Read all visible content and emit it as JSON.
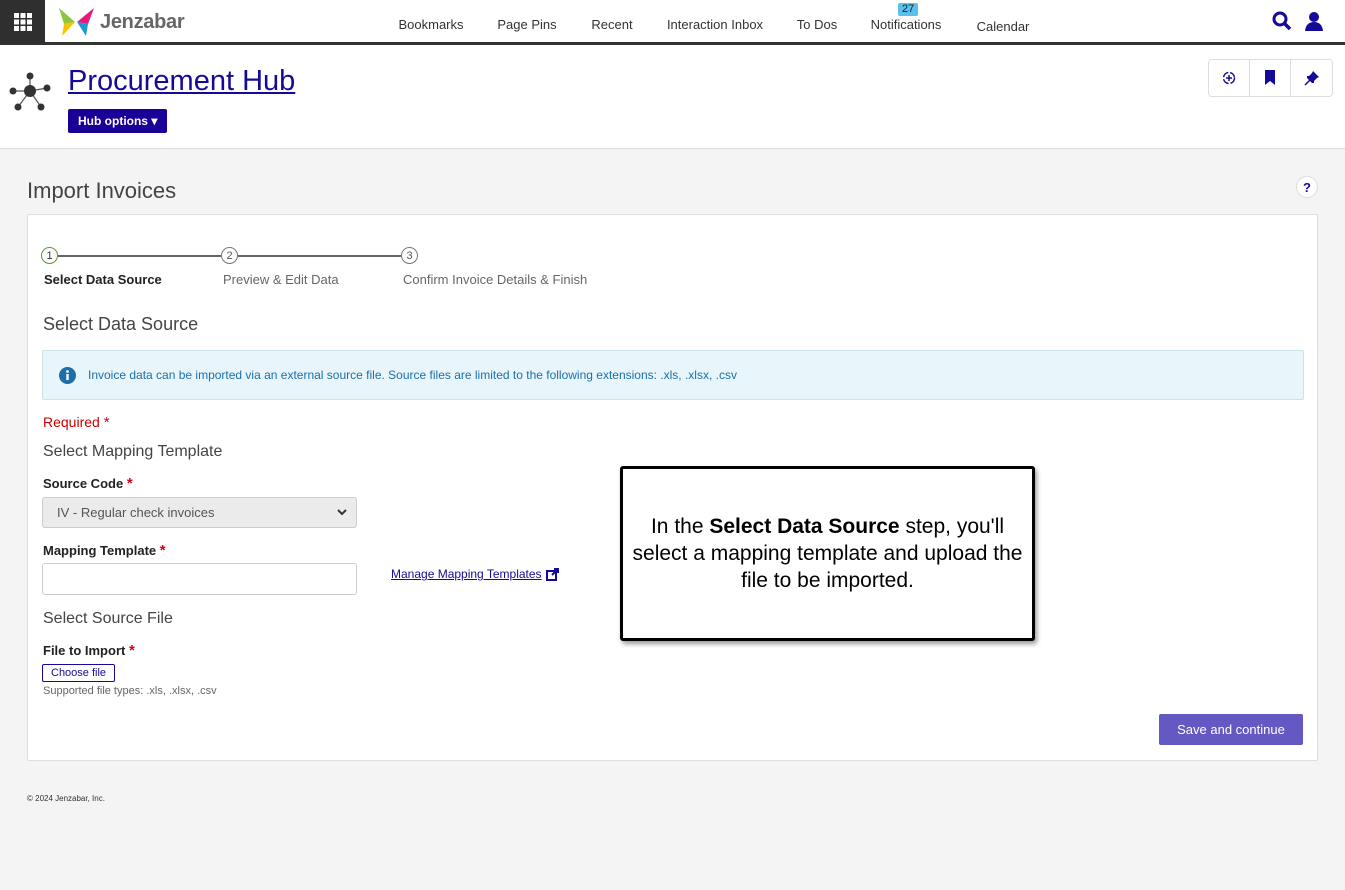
{
  "topbar": {
    "logo": "Jenzabar",
    "nav": [
      "Bookmarks",
      "Page Pins",
      "Recent",
      "Interaction Inbox",
      "To Dos",
      "Notifications",
      "Calendar"
    ],
    "notifications_count": "27"
  },
  "header": {
    "title": "Procurement Hub",
    "hub_options": "Hub options"
  },
  "page": {
    "title": "Import Invoices",
    "help": "?"
  },
  "steps": [
    "Select Data Source",
    "Preview & Edit Data",
    "Confirm Invoice Details & Finish"
  ],
  "step_numbers": [
    "1",
    "2",
    "3"
  ],
  "form": {
    "section_title": "Select Data Source",
    "info": "Invoice data can be imported via an external source file. Source files are limited to the following extensions: .xls, .xlsx, .csv",
    "required": "Required",
    "star": "*",
    "mapping_heading": "Select Mapping Template",
    "source_code_label": "Source Code",
    "source_code_value": "IV - Regular check invoices",
    "mapping_template_label": "Mapping Template",
    "mapping_template_value": "",
    "manage_link": "Manage Mapping Templates",
    "source_file_heading": "Select Source File",
    "file_label": "File to Import",
    "choose_file": "Choose file",
    "supported": "Supported file types: .xls, .xlsx, .csv",
    "save": "Save and continue"
  },
  "callout": {
    "pre": "In the ",
    "bold": "Select Data Source",
    "post": " step, you'll select a mapping template and upload the file to be imported."
  },
  "footer": "© 2024 Jenzabar, Inc.",
  "colors": {
    "brand": "#1a0096",
    "save": "#6459c2",
    "info_bg": "#e8f6fc"
  }
}
